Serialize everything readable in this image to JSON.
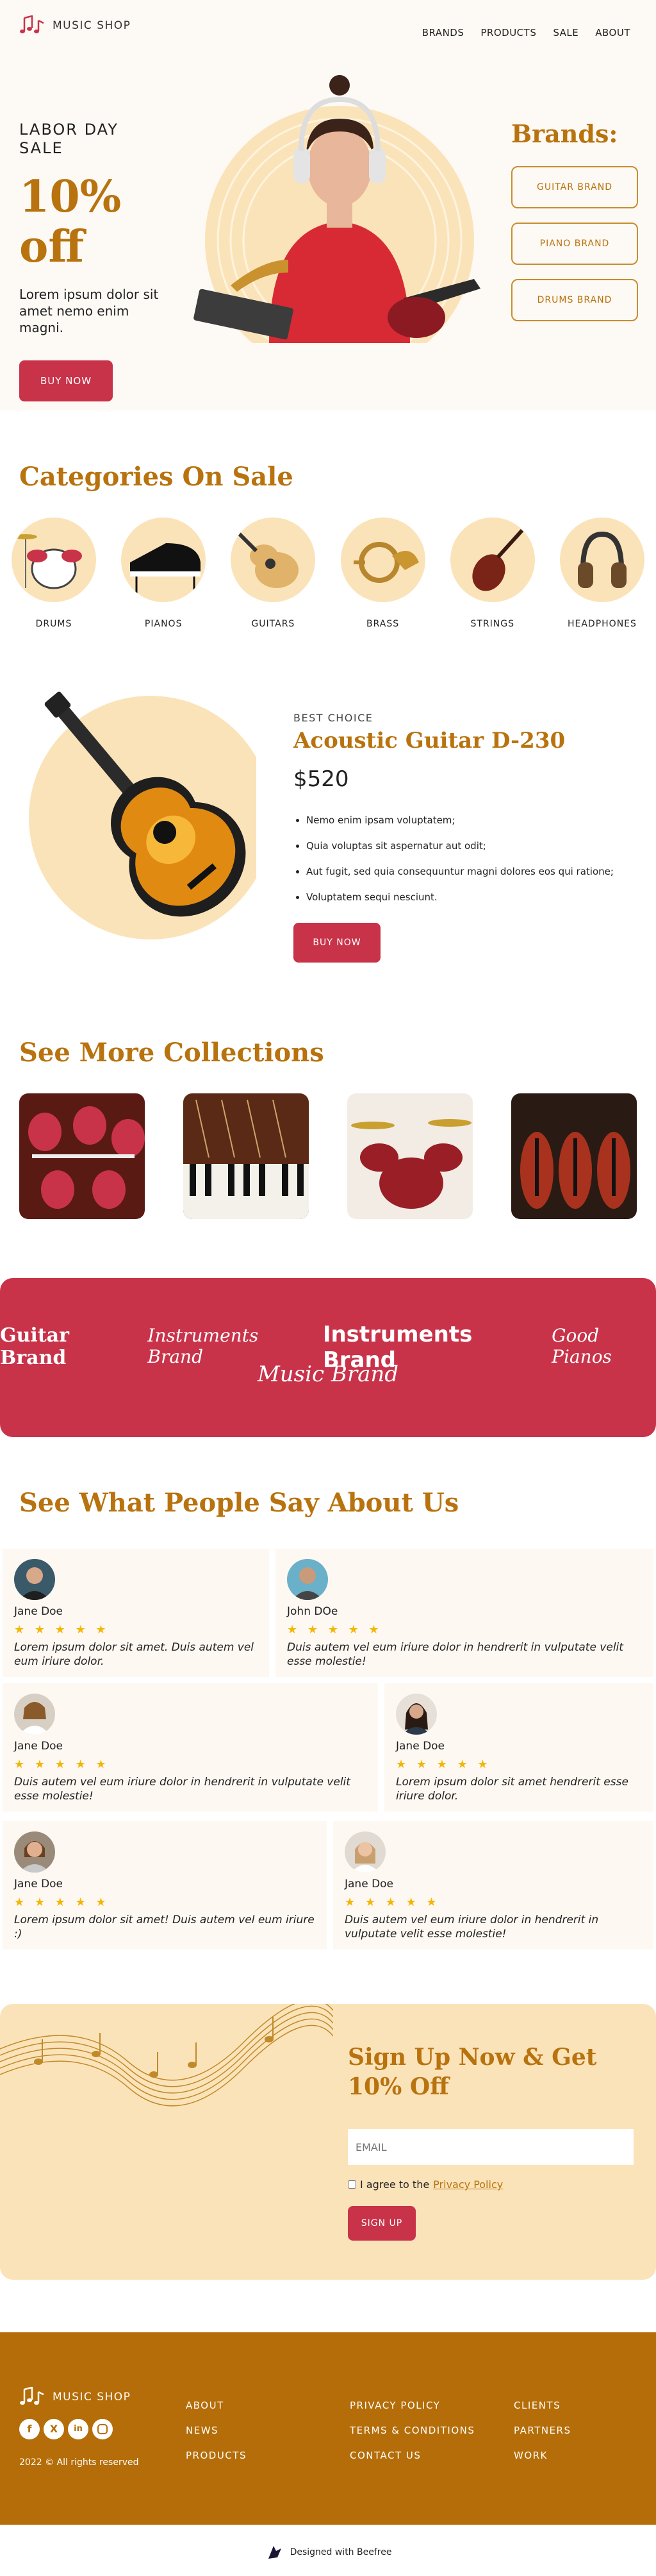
{
  "header": {
    "logo_text": "MUSIC SHOP",
    "nav": [
      "BRANDS",
      "PRODUCTS",
      "SALE",
      "ABOUT"
    ]
  },
  "hero": {
    "line1": "LABOR DAY",
    "line2": "SALE",
    "discount": "10%",
    "discount2": "off",
    "text": "Lorem ipsum dolor sit amet nemo enim magni.",
    "button": "BUY NOW",
    "brands_title": "Brands:",
    "brand_buttons": [
      "GUITAR BRAND",
      "PIANO BRAND",
      "DRUMS BRAND"
    ]
  },
  "categories": {
    "title": "Categories On Sale",
    "items": [
      "DRUMS",
      "PIANOS",
      "GUITARS",
      "BRASS",
      "STRINGS",
      "HEADPHONES"
    ]
  },
  "product": {
    "eyebrow": "BEST CHOICE",
    "name": "Acoustic Guitar D-230",
    "price": "$520",
    "features": [
      "Nemo enim ipsam voluptatem;",
      "Quia voluptas sit aspernatur aut odit;",
      "Aut fugit, sed quia consequuntur magni dolores eos qui ratione;",
      "Voluptatem sequi nesciunt."
    ],
    "button": "BUY NOW"
  },
  "collections": {
    "title": "See More Collections"
  },
  "brand_strip": [
    "Guitar Brand",
    "Instruments Brand",
    "Instruments Brand",
    "Good Pianos",
    "Music Brand"
  ],
  "reviews": {
    "title": "See What People Say About Us",
    "stars": "★ ★ ★ ★ ★",
    "items": [
      {
        "name": "Jane Doe",
        "text": "Lorem ipsum dolor sit amet. Duis autem vel eum iriure dolor."
      },
      {
        "name": "John DOe",
        "text": "Duis autem vel eum iriure dolor in hendrerit in vulputate velit esse molestie!"
      },
      {
        "name": "Jane Doe",
        "text": "Duis autem vel eum iriure dolor in hendrerit in vulputate velit esse molestie!"
      },
      {
        "name": "Jane Doe",
        "text": "Lorem ipsum dolor sit amet hendrerit esse iriure dolor."
      },
      {
        "name": "Jane Doe",
        "text": "Lorem ipsum dolor sit amet! Duis autem vel eum iriure :)"
      },
      {
        "name": "Jane Doe",
        "text": "Duis autem vel eum iriure dolor in hendrerit in vulputate velit esse molestie!"
      }
    ]
  },
  "signup": {
    "title": "Sign Up Now & Get 10% Off",
    "email_placeholder": "EMAIL",
    "agree_prefix": "I agree to the ",
    "policy_link": "Privacy Policy",
    "button": "SIGN UP"
  },
  "footer": {
    "logo_text": "MUSIC SHOP",
    "copyright": "2022 © All rights reserved",
    "col1": [
      "ABOUT",
      "NEWS",
      "PRODUCTS"
    ],
    "col2": [
      "PRIVACY POLICY",
      "TERMS & CONDITIONS",
      "CONTACT US"
    ],
    "col3": [
      "CLIENTS",
      "PARTNERS",
      "WORK"
    ],
    "social_icons": [
      "facebook-icon",
      "x-icon",
      "linkedin-icon",
      "instagram-icon"
    ]
  },
  "badge": {
    "text": "Designed with Beefree"
  },
  "colors": {
    "gold": "#b8730e",
    "red": "#c8334a",
    "peach": "#fbe3b9",
    "cream": "#fdf9f4",
    "footer": "#b46d08"
  }
}
